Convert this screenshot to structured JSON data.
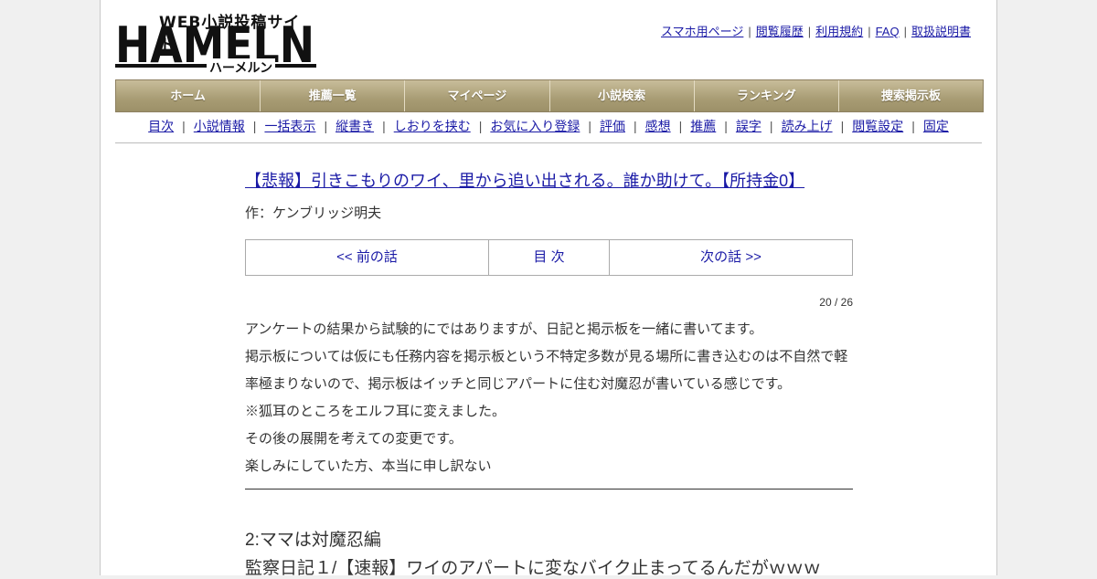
{
  "logo": {
    "tagline": "WEB小説投稿サイト",
    "name": "HAMELN",
    "sub": "ハーメルン"
  },
  "top_links": [
    "スマホ用ページ",
    "閲覧履歴",
    "利用規約",
    "FAQ",
    "取扱説明書"
  ],
  "nav": [
    "ホーム",
    "推薦一覧",
    "マイページ",
    "小説検索",
    "ランキング",
    "捜索掲示板"
  ],
  "subnav": [
    "目次",
    "小説情報",
    "一括表示",
    "縦書き",
    "しおりを挟む",
    "お気に入り登録",
    "評価",
    "感想",
    "推薦",
    "誤字",
    "読み上げ",
    "閲覧設定",
    "固定"
  ],
  "novel": {
    "title": "【悲報】引きこもりのワイ、里から追い出される。誰か助けて。【所持金0】",
    "author": "作：ケンブリッジ明夫"
  },
  "pager": {
    "prev": "<< 前の話",
    "toc": "目 次",
    "next": "次の話 >>"
  },
  "counter": "20 / 26",
  "preface": [
    "アンケートの結果から試験的にではありますが、日記と掲示板を一緒に書いてます。",
    "掲示板については仮にも任務内容を掲示板という不特定多数が見る場所に書き込むのは不自然で軽",
    "率極まりないので、掲示板はイッチと同じアパートに住む対魔忍が書いている感じです。",
    "※狐耳のところをエルフ耳に変えました。",
    "その後の展開を考えての変更です。",
    "楽しみにしていた方、本当に申し訳ない"
  ],
  "chapter": "2:ママは対魔忍編",
  "subtitle": "監察日記１/【速報】ワイのアパートに変なバイク止まってるんだがｗｗｗ"
}
